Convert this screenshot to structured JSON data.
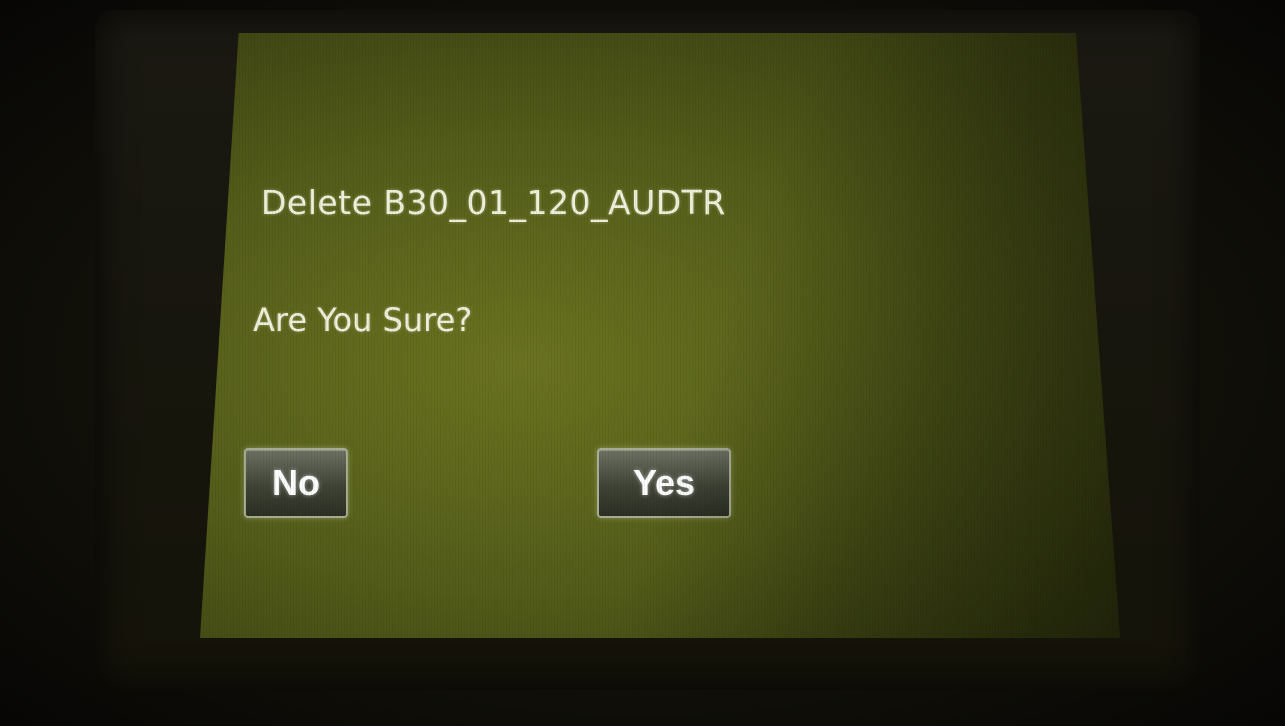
{
  "dialog": {
    "message": "Delete B30_01_120_AUDTR",
    "confirm_prompt": "Are You Sure?",
    "buttons": {
      "no_label": "No",
      "yes_label": "Yes"
    }
  },
  "colors": {
    "screen_background": "#555e1a",
    "text": "#eef0dc",
    "button_fill": "#3f4436",
    "button_border": "#a9ad95"
  }
}
